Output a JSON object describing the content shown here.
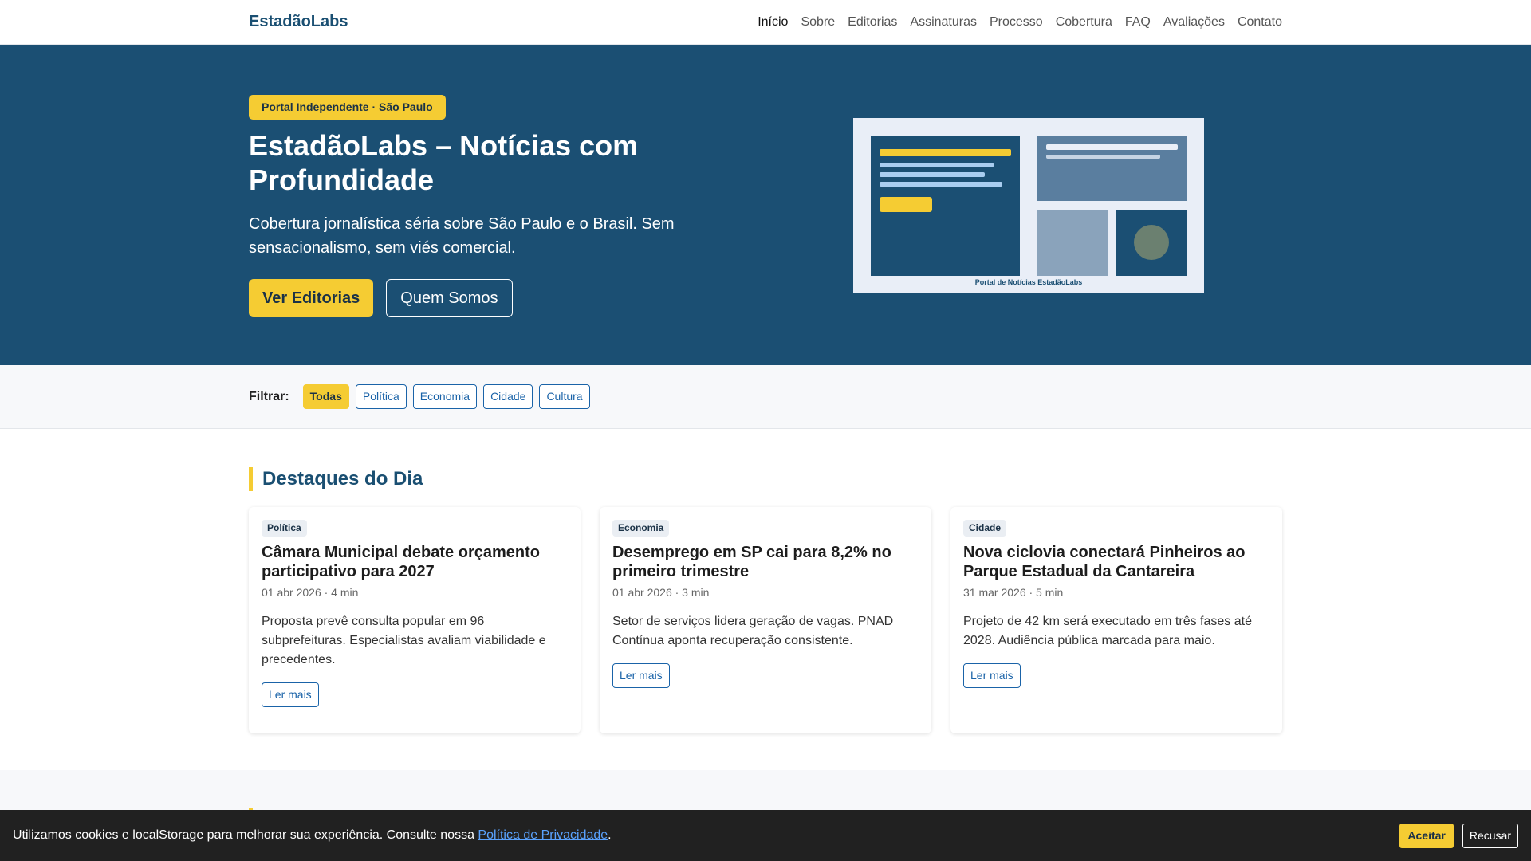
{
  "brand": "EstadãoLabs",
  "nav": [
    "Início",
    "Sobre",
    "Editorias",
    "Assinaturas",
    "Processo",
    "Cobertura",
    "FAQ",
    "Avaliações",
    "Contato"
  ],
  "hero": {
    "badge": "Portal Independente · São Paulo",
    "title": "EstadãoLabs – Notícias com Profundidade",
    "subtitle": "Cobertura jornalística séria sobre São Paulo e o Brasil. Sem sensacionalismo, sem viés comercial.",
    "primary_button": "Ver Editorias",
    "secondary_button": "Quem Somos",
    "illustration_caption": "Portal de Notícias EstadãoLabs"
  },
  "filter": {
    "label": "Filtrar:",
    "chips": [
      "Todas",
      "Política",
      "Economia",
      "Cidade",
      "Cultura"
    ],
    "active": "Todas"
  },
  "highlights": {
    "title": "Destaques do Dia",
    "cards": [
      {
        "tag": "Política",
        "title": "Câmara Municipal debate orçamento participativo para 2027",
        "meta": "01 abr 2026 · 4 min",
        "text": "Proposta prevê consulta popular em 96 subprefeituras. Especialistas avaliam viabilidade e precedentes.",
        "button": "Ler mais"
      },
      {
        "tag": "Economia",
        "title": "Desemprego em SP cai para 8,2% no primeiro trimestre",
        "meta": "01 abr 2026 · 3 min",
        "text": "Setor de serviços lidera geração de vagas. PNAD Contínua aponta recuperação consistente.",
        "button": "Ler mais"
      },
      {
        "tag": "Cidade",
        "title": "Nova ciclovia conectará Pinheiros ao Parque Estadual da Cantareira",
        "meta": "31 mar 2026 · 5 min",
        "text": "Projeto de 42 km será executado em três fases até 2028. Audiência pública marcada para maio.",
        "button": "Ler mais"
      }
    ]
  },
  "cookie": {
    "text": "Utilizamos cookies e localStorage para melhorar sua experiência. Consulte nossa ",
    "link": "Política de Privacidade",
    "suffix": ".",
    "accept": "Aceitar",
    "reject": "Recusar"
  },
  "colors": {
    "primary": "#1b4f73",
    "accent": "#f5cc33",
    "link": "#1a63a8"
  }
}
